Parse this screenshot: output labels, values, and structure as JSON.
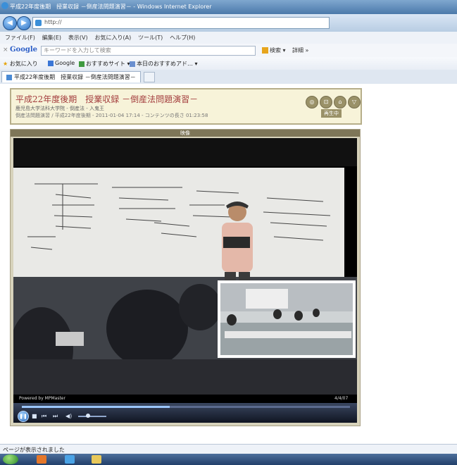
{
  "window": {
    "title": "平成22年度後期　授業収録 －倒産法問題演習－ - Windows Internet Explorer",
    "address": "http://"
  },
  "menu": [
    "ファイル(F)",
    "編集(E)",
    "表示(V)",
    "お気に入り(A)",
    "ツール(T)",
    "ヘルプ(H)"
  ],
  "google_bar": {
    "close": "×",
    "logo": "Google",
    "placeholder": "キーワードを入力して検索",
    "search_label": "検索 ▾",
    "more_label": "詳細 »"
  },
  "favorites_bar": {
    "favorites_label": "お気に入り",
    "items": [
      "Google",
      "おすすめサイト ▾",
      "本日のおすすめアド… ▾"
    ]
  },
  "tab": {
    "label": "平成22年度後期　授業収録 －倒産法問題演習－"
  },
  "page": {
    "title": "平成22年度後期　授業収録 －倒産法問題演習－",
    "subtitle": "鹿児島大学法科大学院 - 倒産法 - 入鬼王",
    "meta": "倒産法問題演習 / 平成22年度後期 - 2011-01-04 17:14 - コンテンツの長さ 01:23:58",
    "playing_status": "再生中"
  },
  "player": {
    "label": "映像",
    "powered_by": "Powered by MPMaster",
    "info": "4/4/07",
    "seek_progress": 0.45,
    "volume_level": 0.35
  },
  "status_bar": "ページが表示されました",
  "colors": {
    "titlebar": "#4b79aa",
    "header_bg": "#f7f3d9",
    "title_red": "#a33d3d",
    "player_frame": "#d7d2bb"
  }
}
